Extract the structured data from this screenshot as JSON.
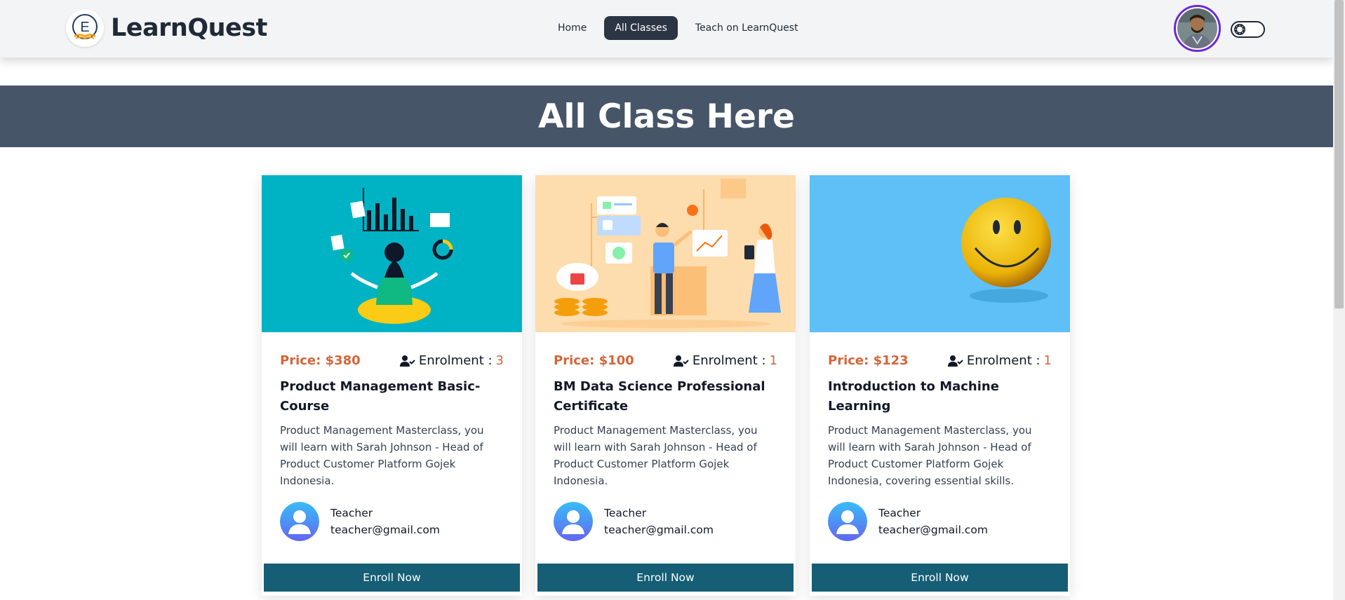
{
  "navbar": {
    "brand": "LearnQuest",
    "logo_letter": "E",
    "links": [
      "Home",
      "All Classes",
      "Teach on LearnQuest"
    ],
    "active_link": "All Classes"
  },
  "banner": {
    "title": "All Class Here"
  },
  "labels": {
    "price_prefix": "Price: ",
    "enrolment": "Enrolment :",
    "enroll_button": "Enroll Now"
  },
  "cards": [
    {
      "price": "Price: $380",
      "enrolment_label": "Enrolment :",
      "enrolment_count": "3",
      "title": "Product Management Basic-Course",
      "description": "Product Management Masterclass, you will learn with Sarah Johnson - Head of Product Customer Platform Gojek Indonesia.",
      "teacher_name": "Teacher",
      "teacher_email": "teacher@gmail.com",
      "button": "Enroll Now"
    },
    {
      "price": "Price: $100",
      "enrolment_label": "Enrolment :",
      "enrolment_count": "1",
      "title": "BM Data Science Professional Certificate",
      "description": "Product Management Masterclass, you will learn with Sarah Johnson - Head of Product Customer Platform Gojek Indonesia.",
      "teacher_name": "Teacher",
      "teacher_email": "teacher@gmail.com",
      "button": "Enroll Now"
    },
    {
      "price": "Price: $123",
      "enrolment_label": "Enrolment :",
      "enrolment_count": "1",
      "title": "Introduction to Machine Learning",
      "description": "Product Management Masterclass, you will learn with Sarah Johnson - Head of Product Customer Platform Gojek Indonesia, covering essential skills.",
      "teacher_name": "Teacher",
      "teacher_email": "teacher@gmail.com",
      "button": "Enroll Now"
    }
  ],
  "colors": {
    "navbar_bg": "#f3f4f6",
    "banner_bg": "#475569",
    "accent_price": "#d4653a",
    "button_bg": "#155e75",
    "active_nav": "#2b3543",
    "avatar_ring": "#6d28d9"
  }
}
